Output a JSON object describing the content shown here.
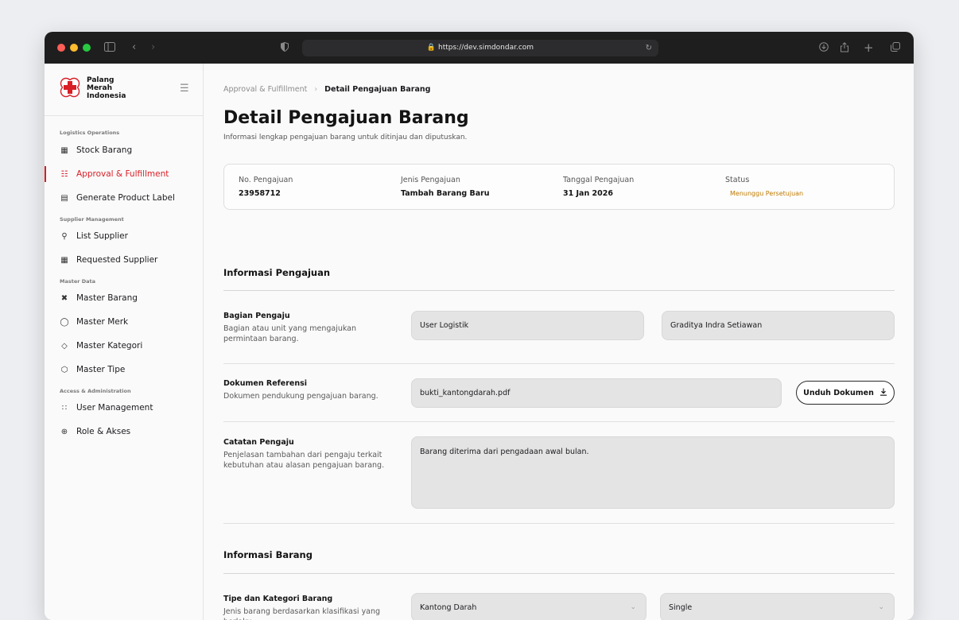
{
  "browser": {
    "url": "https://dev.simdondar.com"
  },
  "brand": {
    "name": "Palang\nMerah\nIndonesia",
    "accent": "#d81f26"
  },
  "sidebar": {
    "sections": [
      {
        "label": "Logistics Operations",
        "items": [
          {
            "label": "Stock Barang",
            "icon": "table-icon",
            "active": false
          },
          {
            "label": "Approval & Fulfillment",
            "icon": "checklist-icon",
            "active": true
          },
          {
            "label": "Generate Product Label",
            "icon": "barcode-icon",
            "active": false
          }
        ]
      },
      {
        "label": "Supplier Management",
        "items": [
          {
            "label": "List Supplier",
            "icon": "user-icon",
            "active": false
          },
          {
            "label": "Requested Supplier",
            "icon": "table-icon",
            "active": false
          }
        ]
      },
      {
        "label": "Master Data",
        "items": [
          {
            "label": "Master Barang",
            "icon": "tools-icon",
            "active": false
          },
          {
            "label": "Master Merk",
            "icon": "award-icon",
            "active": false
          },
          {
            "label": "Master Kategori",
            "icon": "tag-icon",
            "active": false
          },
          {
            "label": "Master Tipe",
            "icon": "box-icon",
            "active": false
          }
        ]
      },
      {
        "label": "Access & Administration",
        "items": [
          {
            "label": "User Management",
            "icon": "users-icon",
            "active": false
          },
          {
            "label": "Role & Akses",
            "icon": "globe-icon",
            "active": false
          }
        ]
      }
    ]
  },
  "breadcrumb": {
    "parent": "Approval & Fulfillment",
    "current": "Detail Pengajuan Barang"
  },
  "page": {
    "title": "Detail Pengajuan Barang",
    "subtitle": "Informasi lengkap pengajuan barang untuk ditinjau dan diputuskan."
  },
  "summary": {
    "no_label": "No. Pengajuan",
    "no_value": "23958712",
    "jenis_label": "Jenis Pengajuan",
    "jenis_value": "Tambah Barang Baru",
    "tanggal_label": "Tanggal Pengajuan",
    "tanggal_value": "31 Jan 2026",
    "status_label": "Status",
    "status_value": "Menunggu Persetujuan",
    "status_color": "#c07a00"
  },
  "info_pengajuan": {
    "title": "Informasi Pengajuan",
    "bagian": {
      "label": "Bagian Pengaju",
      "desc": "Bagian atau unit yang mengajukan permintaan barang.",
      "unit": "User Logistik",
      "name": "Graditya Indra Setiawan"
    },
    "dokumen": {
      "label": "Dokumen Referensi",
      "desc": "Dokumen pendukung pengajuan barang.",
      "file": "bukti_kantongdarah.pdf",
      "button": "Unduh Dokumen"
    },
    "catatan": {
      "label": "Catatan Pengaju",
      "desc": "Penjelasan tambahan dari pengaju terkait kebutuhan atau alasan pengajuan barang.",
      "value": "Barang diterima dari pengadaan awal bulan."
    }
  },
  "info_barang": {
    "title": "Informasi Barang",
    "tipe": {
      "label": "Tipe dan Kategori Barang",
      "desc": "Jenis barang berdasarkan klasifikasi yang berlaku.",
      "kategori": "Kantong Darah",
      "tipe": "Single"
    }
  }
}
